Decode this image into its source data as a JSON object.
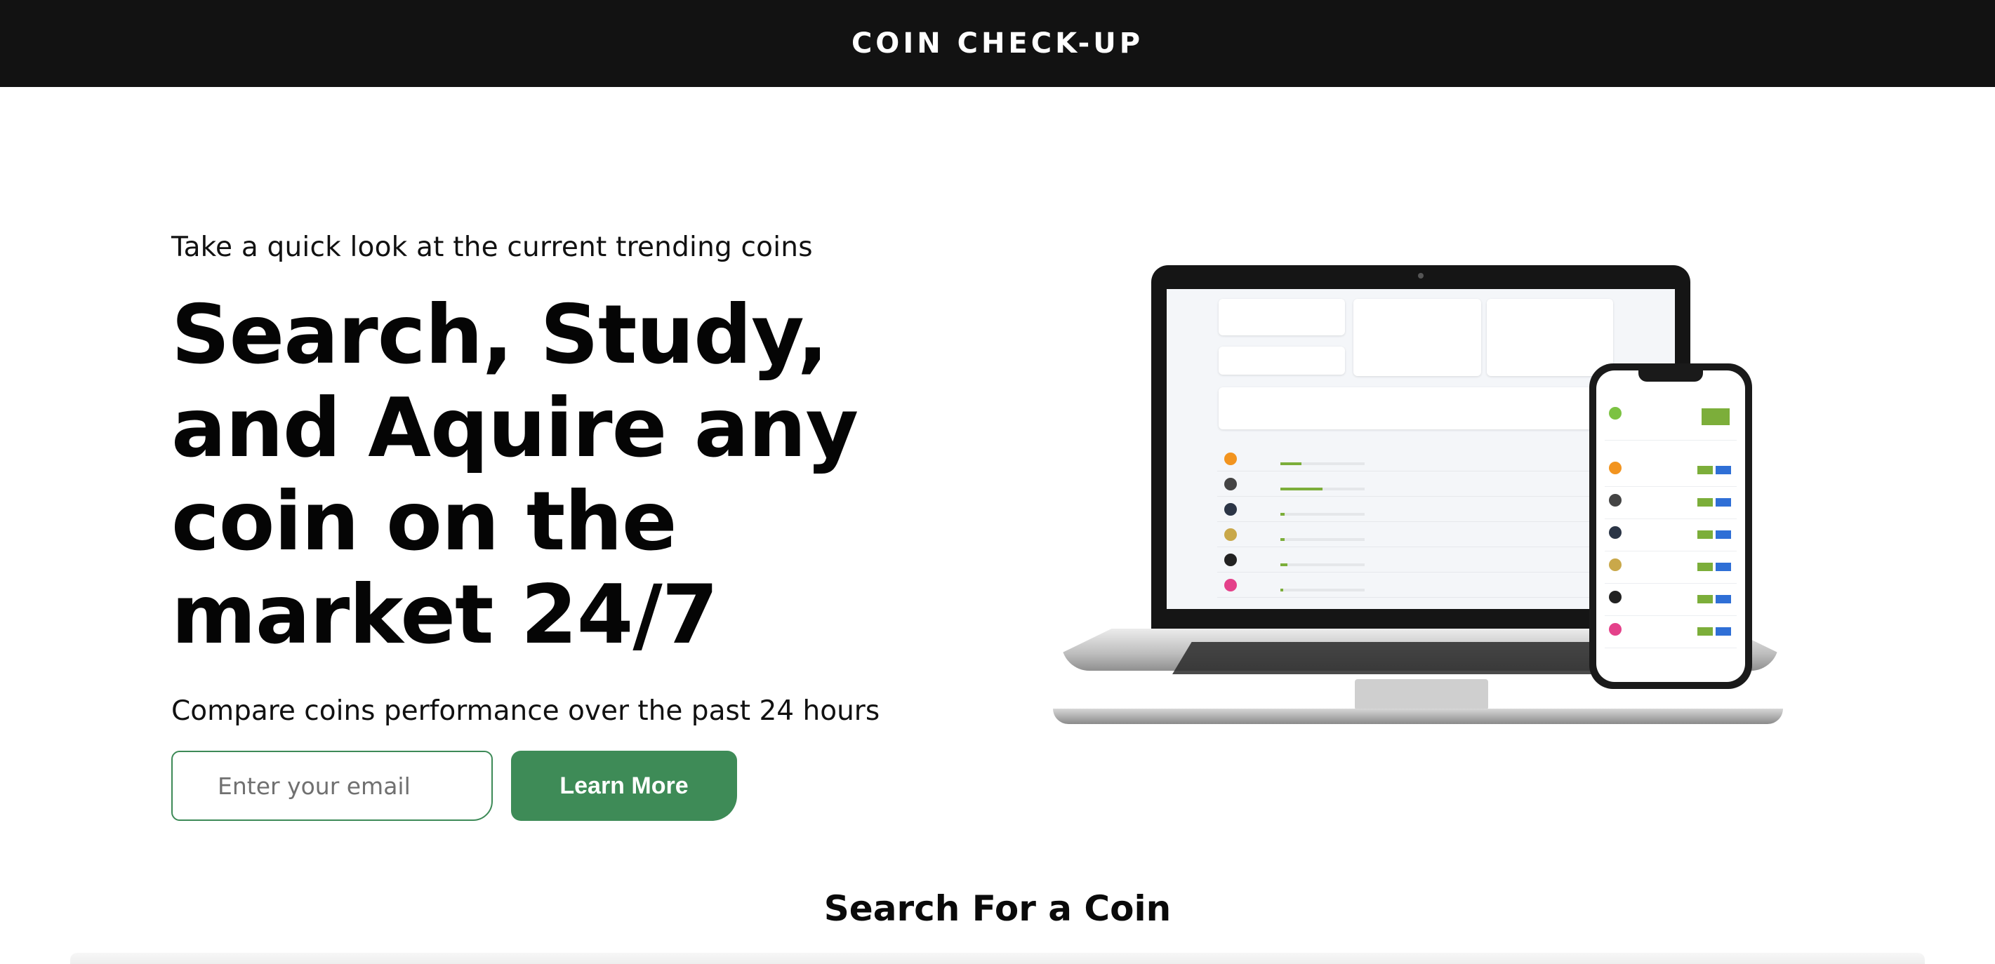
{
  "header": {
    "brand": "COIN CHECK-UP"
  },
  "hero": {
    "kicker": "Take a quick look at the current trending coins",
    "headline": "Search, Study, and Aquire any coin on the market 24/7",
    "subline": "Compare coins performance over the past 24 hours",
    "email_placeholder": "Enter your email",
    "cta_label": "Learn More"
  },
  "search_section": {
    "title": "Search For a Coin"
  },
  "colors": {
    "header_bg": "#121212",
    "accent_green": "#3e8b57"
  }
}
